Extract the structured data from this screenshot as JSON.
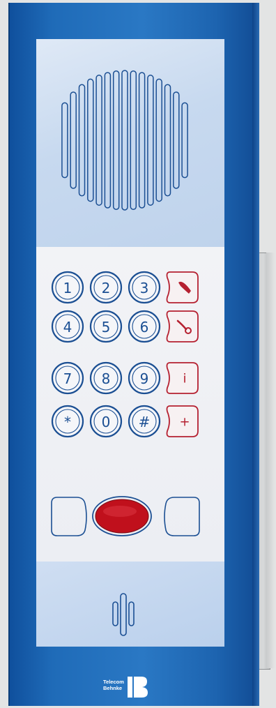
{
  "device": {
    "brand_logo_text": [
      "Telecom",
      "Behnke"
    ],
    "colors": {
      "panel_blue": "#1f6bb8",
      "key_blue": "#1b4f93",
      "function_red": "#b52030",
      "call_button_red": "#c0101c"
    },
    "keypad": {
      "keys": [
        "1",
        "2",
        "3",
        "4",
        "5",
        "6",
        "7",
        "8",
        "9",
        "*",
        "0",
        "#"
      ]
    },
    "function_keys": [
      {
        "icon": "handset-pickup-icon",
        "label": ""
      },
      {
        "icon": "handset-hangup-icon",
        "label": ""
      },
      {
        "icon": "info-icon",
        "label": "i"
      },
      {
        "icon": "plus-icon",
        "label": "+"
      }
    ]
  }
}
